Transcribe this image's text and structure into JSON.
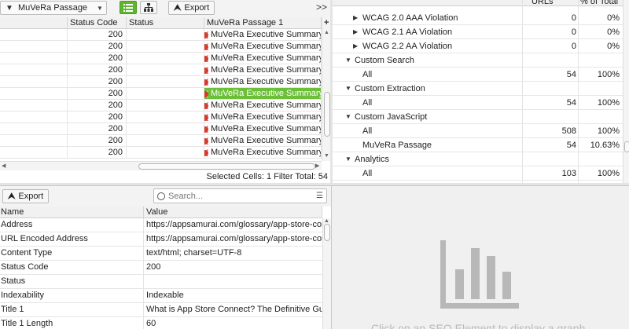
{
  "top_left": {
    "filter_label": "MuVeRa Passage",
    "export_label": "Export",
    "columns": [
      "",
      "Status Code",
      "Status",
      "MuVeRa Passage  1"
    ],
    "rows": [
      {
        "code": "200",
        "status": "",
        "passage": "MuVeRa Executive Summary..."
      },
      {
        "code": "200",
        "status": "",
        "passage": "MuVeRa Executive Summary..."
      },
      {
        "code": "200",
        "status": "",
        "passage": "MuVeRa Executive Summary..."
      },
      {
        "code": "200",
        "status": "",
        "passage": "MuVeRa Executive Summary..."
      },
      {
        "code": "200",
        "status": "",
        "passage": "MuVeRa Executive Summary..."
      },
      {
        "code": "200",
        "status": "",
        "passage": "MuVeRa Executive Summary...",
        "selected": true
      },
      {
        "code": "200",
        "status": "",
        "passage": "MuVeRa Executive Summary..."
      },
      {
        "code": "200",
        "status": "",
        "passage": "MuVeRa Executive Summary..."
      },
      {
        "code": "200",
        "status": "",
        "passage": "MuVeRa Executive Summary..."
      },
      {
        "code": "200",
        "status": "",
        "passage": "MuVeRa Executive Summary..."
      },
      {
        "code": "200",
        "status": "",
        "passage": "MuVeRa Executive Summary..."
      }
    ],
    "status_bar": "Selected Cells:  1  Filter Total:  54",
    "accent_color": "#6cbf38"
  },
  "top_right": {
    "columns": [
      "URLs",
      "% of Total"
    ],
    "rows": [
      {
        "name": "WCAG 2.0 AAA Violation",
        "level": 1,
        "twisty": "collapsed",
        "urls": "0",
        "pct": "0%"
      },
      {
        "name": "WCAG 2.1 AA Violation",
        "level": 1,
        "twisty": "collapsed",
        "urls": "0",
        "pct": "0%"
      },
      {
        "name": "WCAG 2.2 AA Violation",
        "level": 1,
        "twisty": "collapsed",
        "urls": "0",
        "pct": "0%"
      },
      {
        "name": "Custom Search",
        "level": 0,
        "twisty": "expanded",
        "urls": "",
        "pct": ""
      },
      {
        "name": "All",
        "level": 1,
        "twisty": "",
        "urls": "54",
        "pct": "100%"
      },
      {
        "name": "Custom Extraction",
        "level": 0,
        "twisty": "expanded",
        "urls": "",
        "pct": ""
      },
      {
        "name": "All",
        "level": 1,
        "twisty": "",
        "urls": "54",
        "pct": "100%"
      },
      {
        "name": "Custom JavaScript",
        "level": 0,
        "twisty": "expanded",
        "urls": "",
        "pct": ""
      },
      {
        "name": "All",
        "level": 1,
        "twisty": "",
        "urls": "508",
        "pct": "100%"
      },
      {
        "name": "MuVeRa Passage",
        "level": 1,
        "twisty": "",
        "urls": "54",
        "pct": "10.63%"
      },
      {
        "name": "Analytics",
        "level": 0,
        "twisty": "expanded",
        "urls": "",
        "pct": ""
      },
      {
        "name": "All",
        "level": 1,
        "twisty": "",
        "urls": "103",
        "pct": "100%"
      }
    ]
  },
  "bottom_left": {
    "export_label": "Export",
    "search_placeholder": "Search...",
    "columns": [
      "Name",
      "Value"
    ],
    "rows": [
      {
        "name": "Address",
        "value": "https://appsamurai.com/glossary/app-store-connect/"
      },
      {
        "name": "URL Encoded Address",
        "value": "https://appsamurai.com/glossary/app-store-connect/"
      },
      {
        "name": "Content Type",
        "value": "text/html; charset=UTF-8"
      },
      {
        "name": "Status Code",
        "value": "200"
      },
      {
        "name": "Status",
        "value": ""
      },
      {
        "name": "Indexability",
        "value": "Indexable"
      },
      {
        "name": "Title 1",
        "value": "What is App Store Connect? The Definitive Guide | AppSa"
      },
      {
        "name": "Title 1 Length",
        "value": "60"
      }
    ]
  },
  "bottom_right": {
    "message": "Click on an SEO Element to display a graph",
    "icon": "bar-chart-icon"
  }
}
